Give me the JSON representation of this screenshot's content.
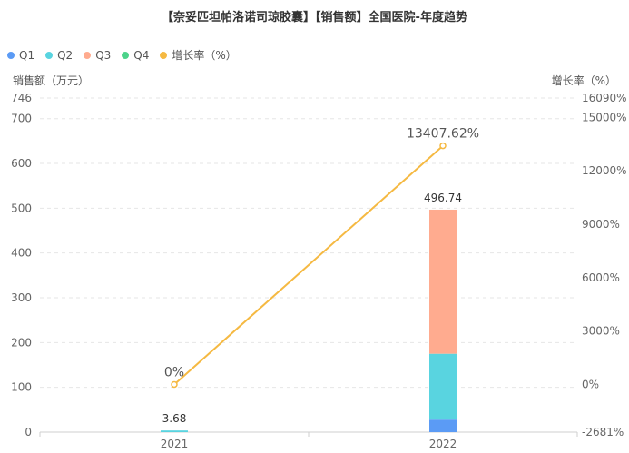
{
  "chart_data": {
    "type": "bar",
    "title": "【奈妥匹坦帕洛诺司琼胶囊】【销售额】全国医院-年度趋势",
    "categories": [
      "2021",
      "2022"
    ],
    "stacked": true,
    "series": [
      {
        "name": "Q1",
        "color": "#5b9bf5",
        "values": [
          0,
          28.0
        ]
      },
      {
        "name": "Q2",
        "color": "#59d4e0",
        "values": [
          3.68,
          147.0
        ]
      },
      {
        "name": "Q3",
        "color": "#ffab8f",
        "values": [
          0,
          321.74
        ]
      },
      {
        "name": "Q4",
        "color": "#4cd38a",
        "values": [
          0,
          0
        ]
      }
    ],
    "totals": [
      "3.68",
      "496.74"
    ],
    "line": {
      "name": "增长率（%）",
      "color": "#f5b942",
      "values": [
        0,
        13407.62
      ],
      "labels": [
        "0%",
        "13407.62%"
      ]
    },
    "ylabel_left": "销售额（万元）",
    "ylabel_right": "增长率（%）",
    "ylim_left": [
      0,
      746
    ],
    "yticks_left": [
      "0",
      "100",
      "200",
      "300",
      "400",
      "500",
      "600",
      "700",
      "746"
    ],
    "yticks_left_values": [
      0,
      100,
      200,
      300,
      400,
      500,
      600,
      700,
      746
    ],
    "ylim_right": [
      -2681,
      16090
    ],
    "yticks_right": [
      "-2681%",
      "0%",
      "3000%",
      "6000%",
      "9000%",
      "12000%",
      "15000%",
      "16090%"
    ],
    "yticks_right_values": [
      -2681,
      0,
      3000,
      6000,
      9000,
      12000,
      15000,
      16090
    ],
    "grid": true,
    "legend_position": "top-left"
  }
}
